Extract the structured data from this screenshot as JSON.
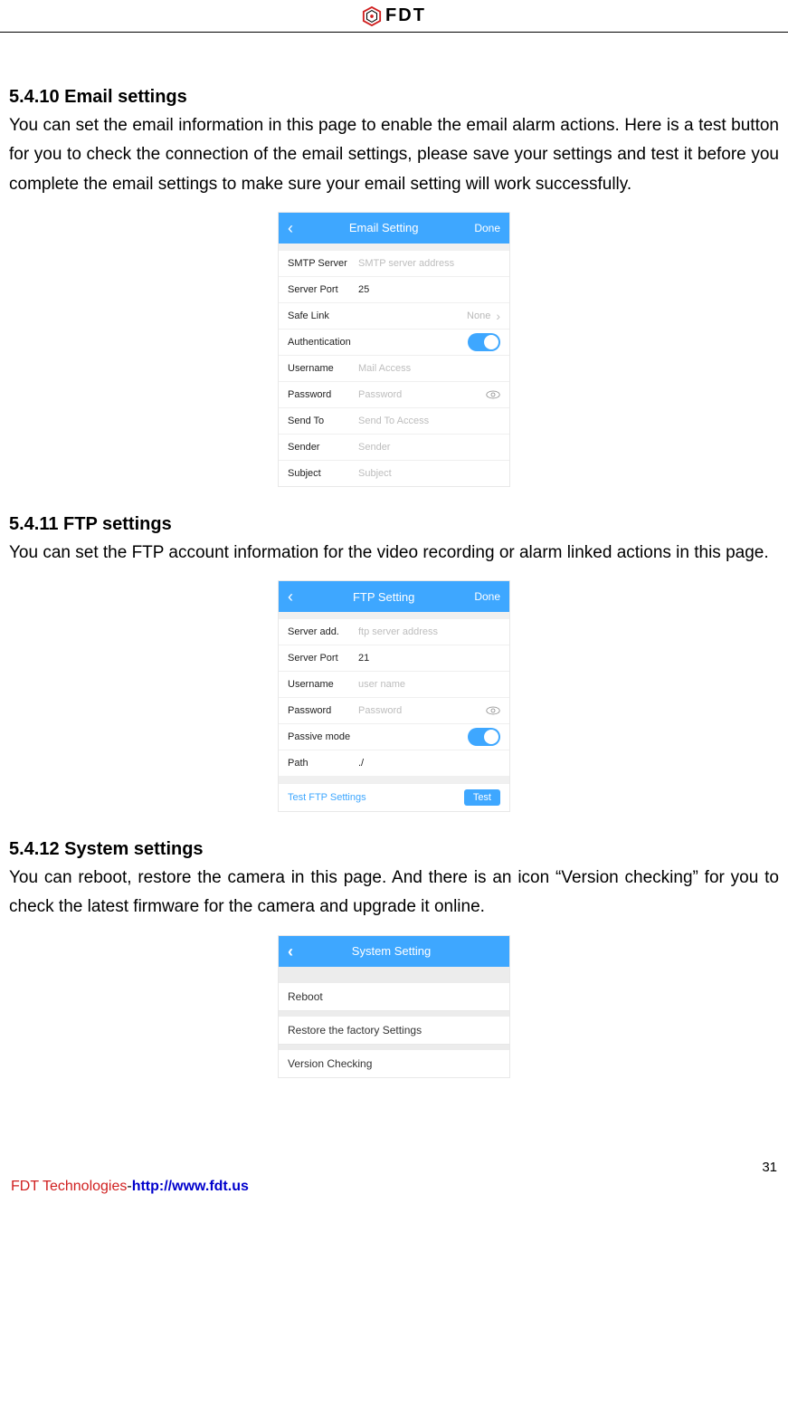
{
  "header": {
    "logo_text": "FDT"
  },
  "sections": {
    "email": {
      "heading": "5.4.10 Email settings",
      "body": "You can set the email information in this page to enable the email alarm actions. Here is a test button for you to check the connection of the email settings, please save your settings and test it before you complete the email settings to make sure your email setting will work successfully.",
      "screen": {
        "title": "Email Setting",
        "done": "Done",
        "rows": {
          "smtp_label": "SMTP Server",
          "smtp_ph": "SMTP server address",
          "port_label": "Server Port",
          "port_value": "25",
          "safe_label": "Safe Link",
          "safe_value": "None",
          "auth_label": "Authentication",
          "user_label": "Username",
          "user_ph": "Mail Access",
          "pass_label": "Password",
          "pass_ph": "Password",
          "sendto_label": "Send To",
          "sendto_ph": "Send To Access",
          "sender_label": "Sender",
          "sender_ph": "Sender",
          "subject_label": "Subject",
          "subject_ph": "Subject"
        }
      }
    },
    "ftp": {
      "heading": "5.4.11 FTP settings",
      "body": "You can set the FTP account information for the video recording or alarm linked actions in this page.",
      "screen": {
        "title": "FTP Setting",
        "done": "Done",
        "rows": {
          "server_label": "Server add.",
          "server_ph": "ftp server address",
          "port_label": "Server Port",
          "port_value": "21",
          "user_label": "Username",
          "user_ph": "user name",
          "pass_label": "Password",
          "pass_ph": "Password",
          "passive_label": "Passive mode",
          "path_label": "Path",
          "path_value": "./"
        },
        "test_link": "Test FTP Settings",
        "test_btn": "Test"
      }
    },
    "system": {
      "heading": "5.4.12 System settings",
      "body": "You can reboot, restore the camera in this page. And there is an icon “Version checking” for you to check the latest firmware for the camera and upgrade it online.",
      "screen": {
        "title": "System Setting",
        "items": {
          "reboot": "Reboot",
          "restore": "Restore the factory Settings",
          "version": "Version Checking"
        }
      }
    }
  },
  "footer": {
    "page": "31",
    "company": "FDT Technologies",
    "dash": "-",
    "url": "http://www.fdt.us"
  }
}
